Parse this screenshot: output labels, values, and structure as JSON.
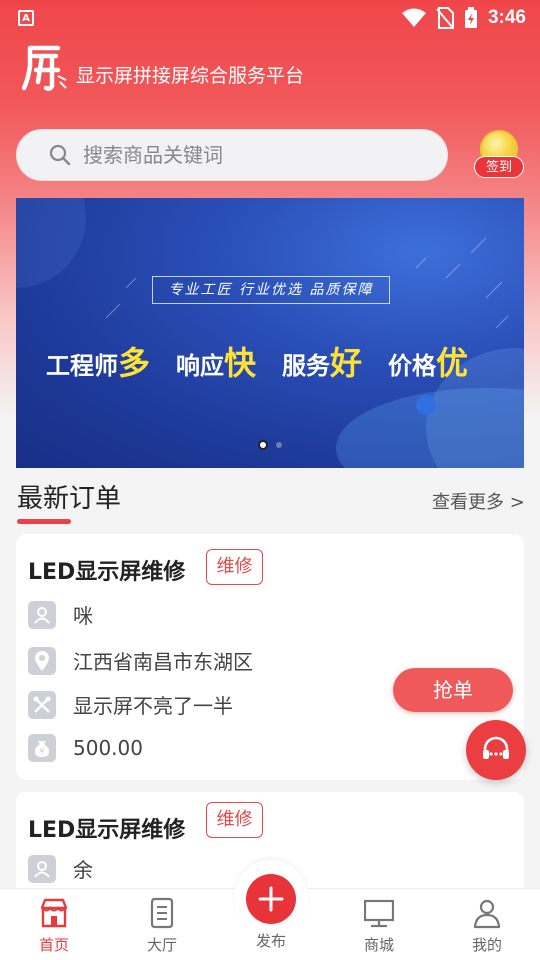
{
  "status_bar": {
    "time": "3:46",
    "left_icon": "A"
  },
  "header": {
    "title": "显示屏拼接屏综合服务平台"
  },
  "search": {
    "placeholder": "搜索商品关键词"
  },
  "signin": {
    "label": "签到"
  },
  "banner": {
    "tagline": "专业工匠 行业优选 品质保障",
    "features": [
      {
        "text": "工程师",
        "emphasis": "多"
      },
      {
        "text": "响应",
        "emphasis": "快"
      },
      {
        "text": "服务",
        "emphasis": "好"
      },
      {
        "text": "价格",
        "emphasis": "优"
      }
    ]
  },
  "section": {
    "title": "最新订单",
    "more": "查看更多 >"
  },
  "orders": [
    {
      "title": "LED显示屏维修",
      "tag": "维修",
      "name": "咪",
      "address": "江西省南昌市东湖区",
      "issue": "显示屏不亮了一半",
      "price": "500.00",
      "action": "抢单"
    },
    {
      "title": "LED显示屏维修",
      "tag": "维修",
      "name": "余"
    }
  ],
  "nav": {
    "home": "首页",
    "hall": "大厅",
    "publish": "发布",
    "mall": "商城",
    "mine": "我的"
  },
  "colors": {
    "primary": "#e8393f",
    "banner": "#2a4fb8",
    "highlight": "#ffe236"
  }
}
